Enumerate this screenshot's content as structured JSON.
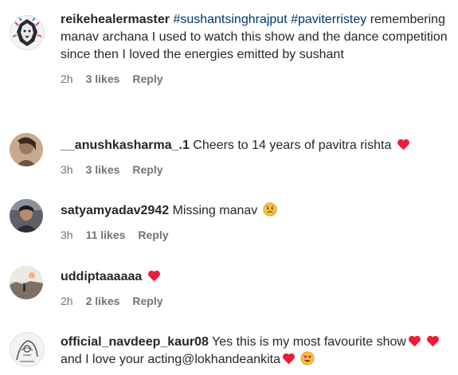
{
  "comments": [
    {
      "username": "reikehealermaster",
      "hashtags": "#sushantsinghrajput #paviterristey",
      "text": "remembering manav archana I used to watch this show and the dance competition since then I loved the energies emitted by sushant",
      "time": "2h",
      "likes": "3 likes",
      "reply": "Reply",
      "avatar_icon": "lion-avatar-icon"
    },
    {
      "username": "__anushkasharma_.1",
      "text": "Cheers to 14 years of pavitra rishta",
      "time": "3h",
      "likes": "3 likes",
      "reply": "Reply",
      "avatar_icon": "profile-photo-icon"
    },
    {
      "username": "satyamyadav2942",
      "text": "Missing manav",
      "time": "3h",
      "likes": "11 likes",
      "reply": "Reply",
      "avatar_icon": "profile-photo-icon"
    },
    {
      "username": "uddiptaaaaaa",
      "text": "",
      "time": "2h",
      "likes": "2 likes",
      "reply": "Reply",
      "avatar_icon": "landscape-avatar-icon"
    },
    {
      "username": "official_navdeep_kaur08",
      "text": "Yes this is my most favourite show",
      "text2": "and I love your acting@lokhandeankita",
      "avatar_icon": "sketch-avatar-icon"
    }
  ],
  "colors": {
    "heart": "#ed1c3a",
    "meta_text": "#737373",
    "hashtag": "#00376b"
  }
}
